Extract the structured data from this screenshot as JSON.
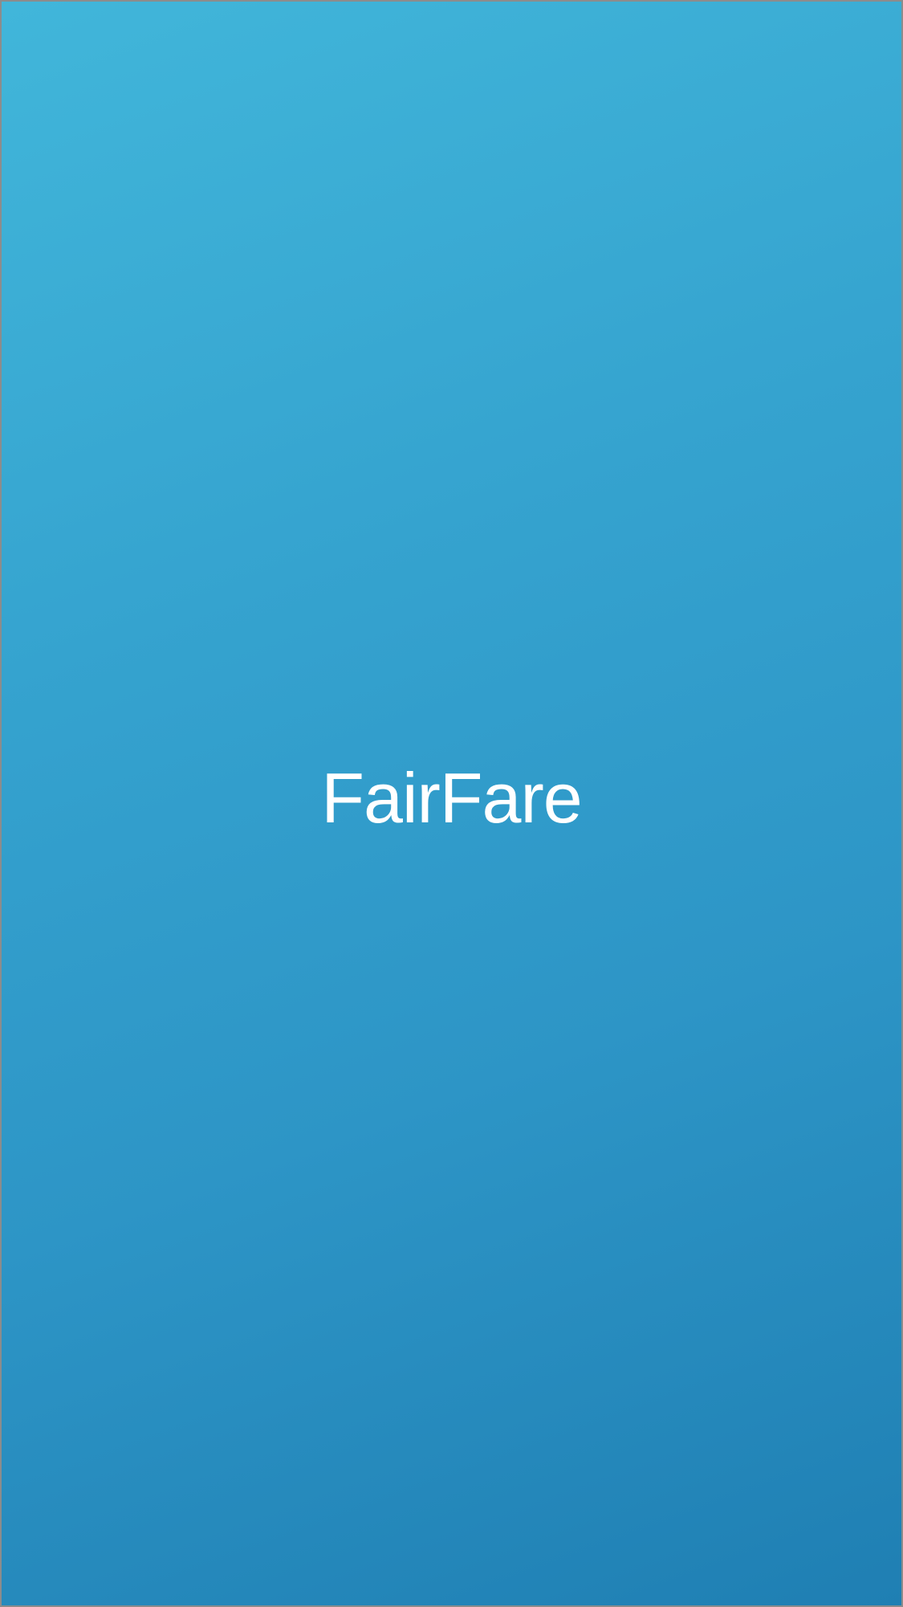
{
  "splash": {
    "app_name": "FairFare"
  },
  "colors": {
    "gradient_top": "#41b6da",
    "gradient_bottom": "#1f7fb3",
    "text": "#ffffff",
    "frame_border": "#8c8c8c"
  }
}
